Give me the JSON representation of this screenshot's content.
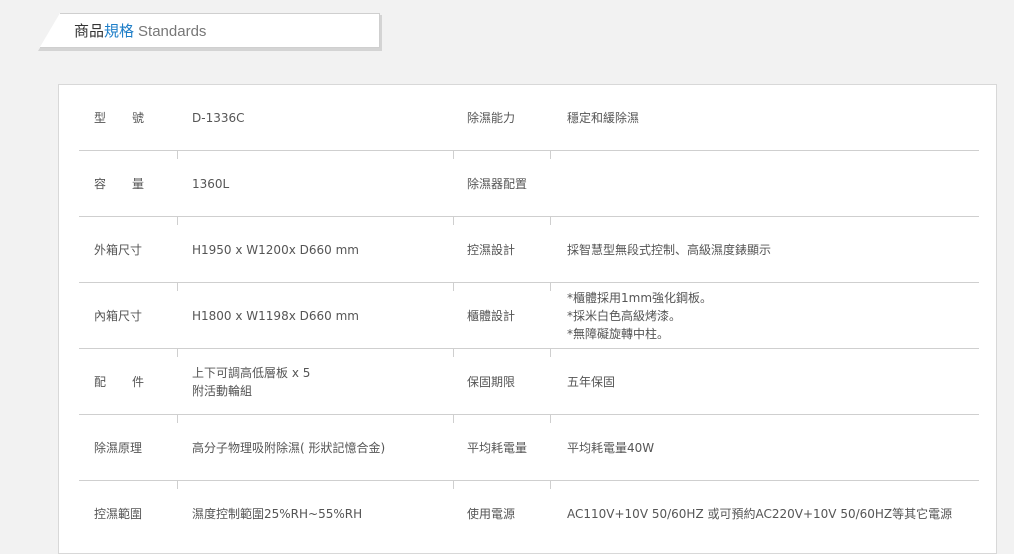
{
  "header": {
    "title_part1": "商品",
    "title_part2": "規格",
    "title_part3": "Standards"
  },
  "specs": [
    {
      "label1_a": "型",
      "label1_b": "號",
      "value1": "D-1336C",
      "label2": "除濕能力",
      "value2": "穩定和緩除濕"
    },
    {
      "label1_a": "容",
      "label1_b": "量",
      "value1": "1360L",
      "label2": "除濕器配置",
      "value2": ""
    },
    {
      "label1": "外箱尺寸",
      "value1": "H1950 x W1200x D660 mm",
      "label2": "控濕設計",
      "value2": "採智慧型無段式控制、高級濕度錶顯示"
    },
    {
      "label1": "內箱尺寸",
      "value1": "H1800 x W1198x D660 mm",
      "label2": "櫃體設計",
      "value2_lines": [
        "*櫃體採用1mm強化鋼板。",
        "*採米白色高級烤漆。",
        "*無障礙旋轉中柱。"
      ]
    },
    {
      "label1_a": "配",
      "label1_b": "件",
      "value1_lines": [
        "上下可調高低層板 x 5",
        "附活動輪組"
      ],
      "label2": "保固期限",
      "value2": "五年保固"
    },
    {
      "label1": "除濕原理",
      "value1": "高分子物理吸附除濕( 形狀記憶合金)",
      "label2": "平均耗電量",
      "value2": "平均耗電量40W"
    },
    {
      "label1": "控濕範圍",
      "value1": "濕度控制範圍25%RH~55%RH",
      "label2": "使用電源",
      "value2": "AC110V+10V 50/60HZ 或可預約AC220V+10V 50/60HZ等其它電源"
    }
  ]
}
